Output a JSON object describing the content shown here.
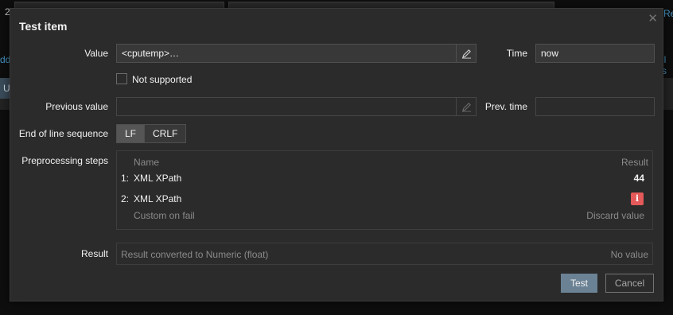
{
  "background": {
    "left_digit": "2",
    "left_link": "dd",
    "right_link": "Re",
    "right_link2": "ll s",
    "left_button": "U"
  },
  "dialog": {
    "title": "Test item",
    "close_icon": "close-icon",
    "value": {
      "label": "Value",
      "text": "<cputemp>…",
      "icon": "pencil-icon"
    },
    "time": {
      "label": "Time",
      "value": "now"
    },
    "not_supported": {
      "label": "Not supported",
      "checked": false
    },
    "previous_value": {
      "label": "Previous value",
      "value": "",
      "icon": "pencil-icon"
    },
    "prev_time": {
      "label": "Prev. time",
      "value": ""
    },
    "eol": {
      "label": "End of line sequence",
      "options": [
        "LF",
        "CRLF"
      ],
      "selected": "LF"
    },
    "preprocessing": {
      "label": "Preprocessing steps",
      "header_name": "Name",
      "header_result": "Result",
      "steps": [
        {
          "num": "1:",
          "name": "XML XPath",
          "result": "44"
        },
        {
          "num": "2:",
          "name": "XML XPath",
          "result_icon": "error-info-icon",
          "sub_label": "Custom on fail",
          "sub_value": "Discard value"
        }
      ]
    },
    "result": {
      "label": "Result",
      "text": "Result converted to Numeric (float)",
      "value": "No value"
    },
    "buttons": {
      "test": "Test",
      "cancel": "Cancel"
    }
  },
  "colors": {
    "accent_button": "#6b8294",
    "error": "#e45959",
    "dialog_bg": "#2b2b2b"
  }
}
